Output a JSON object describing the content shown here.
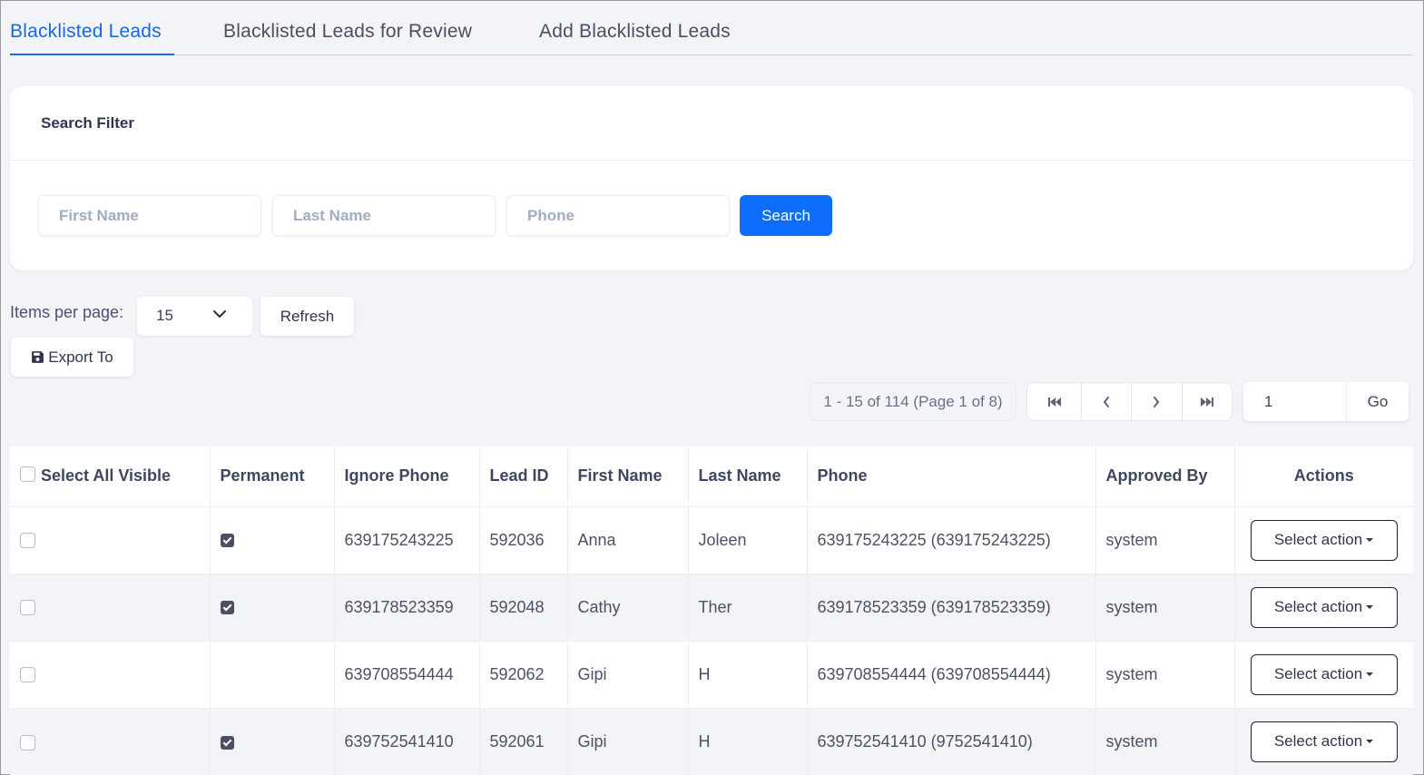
{
  "tabs": [
    {
      "label": "Blacklisted Leads",
      "active": true
    },
    {
      "label": "Blacklisted Leads for Review",
      "active": false
    },
    {
      "label": "Add Blacklisted Leads",
      "active": false
    }
  ],
  "search_filter": {
    "title": "Search Filter",
    "first_name_placeholder": "First Name",
    "last_name_placeholder": "Last Name",
    "phone_placeholder": "Phone",
    "search_label": "Search"
  },
  "toolbar": {
    "items_per_page_label": "Items per page:",
    "items_per_page_value": "15",
    "refresh_label": "Refresh",
    "export_label": "Export To"
  },
  "pagination": {
    "info": "1 - 15 of 114 (Page 1 of 8)",
    "page_input_value": "1",
    "go_label": "Go"
  },
  "table": {
    "headers": {
      "select_all": "Select All Visible",
      "permanent": "Permanent",
      "ignore_phone": "Ignore Phone",
      "lead_id": "Lead ID",
      "first_name": "First Name",
      "last_name": "Last Name",
      "phone": "Phone",
      "approved_by": "Approved By",
      "actions": "Actions"
    },
    "rows": [
      {
        "permanent": true,
        "ignore_phone": "639175243225",
        "lead_id": "592036",
        "first_name": "Anna",
        "last_name": "Joleen",
        "phone": "639175243225 (639175243225)",
        "approved_by": "system",
        "action": "Select action"
      },
      {
        "permanent": true,
        "ignore_phone": "639178523359",
        "lead_id": "592048",
        "first_name": "Cathy",
        "last_name": "Ther",
        "phone": "639178523359 (639178523359)",
        "approved_by": "system",
        "action": "Select action"
      },
      {
        "permanent": false,
        "ignore_phone": "639708554444",
        "lead_id": "592062",
        "first_name": "Gipi",
        "last_name": "H",
        "phone": "639708554444 (639708554444)",
        "approved_by": "system",
        "action": "Select action"
      },
      {
        "permanent": true,
        "ignore_phone": "639752541410",
        "lead_id": "592061",
        "first_name": "Gipi",
        "last_name": "H",
        "phone": "639752541410 (9752541410)",
        "approved_by": "system",
        "action": "Select action"
      }
    ]
  }
}
